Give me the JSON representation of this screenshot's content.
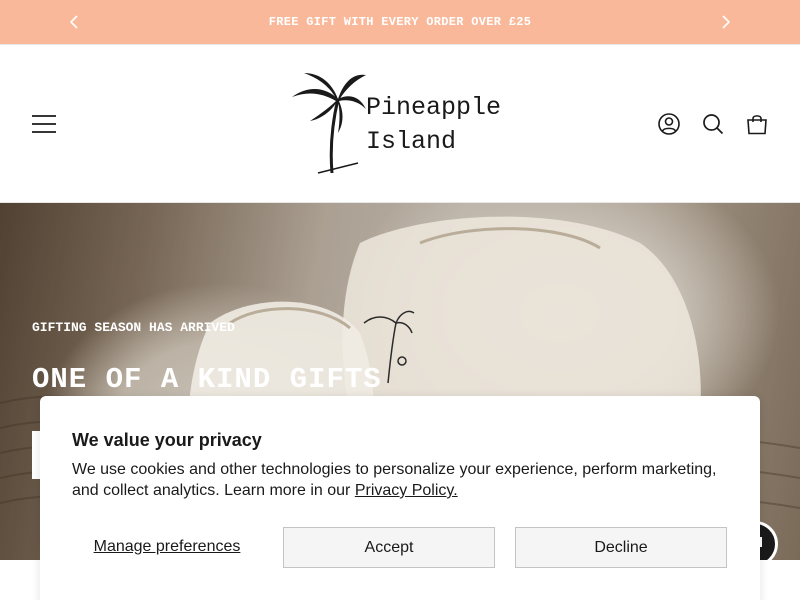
{
  "announcement": {
    "text": "FREE GIFT WITH EVERY ORDER OVER £25",
    "prev_icon": "chevron-left-icon",
    "next_icon": "chevron-right-icon"
  },
  "header": {
    "logo_line1": "Pineapple",
    "logo_line2": "Island",
    "icons": [
      "menu-icon",
      "account-icon",
      "search-icon",
      "bag-icon"
    ]
  },
  "hero": {
    "eyebrow": "GIFTING SEASON HAS ARRIVED",
    "title": "ONE OF A KIND GIFTS"
  },
  "cookie_banner": {
    "title": "We value your privacy",
    "body": "We use cookies and other technologies to personalize your experience, perform marketing, and collect analytics. Learn more in our ",
    "policy_link": "Privacy Policy.",
    "manage_label": "Manage preferences",
    "accept_label": "Accept",
    "decline_label": "Decline"
  },
  "colors": {
    "announcement_bg": "#f9b89a",
    "text": "#1a1a1a",
    "button_bg": "#f5f5f5"
  }
}
